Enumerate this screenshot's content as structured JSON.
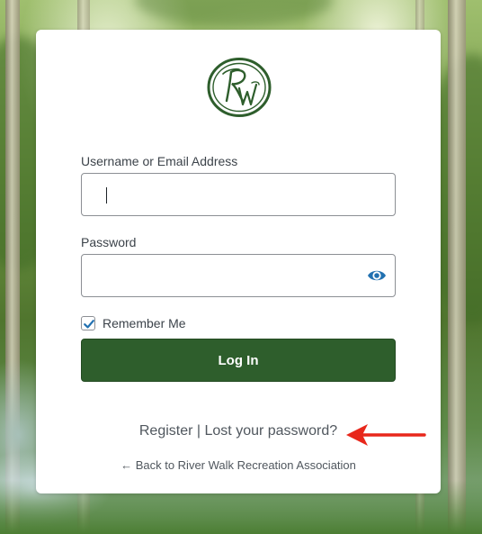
{
  "logo": {
    "monogram": "RW",
    "color": "#2e5e2c"
  },
  "form": {
    "username_label": "Username or Email Address",
    "username_value": "",
    "password_label": "Password",
    "password_value": "",
    "show_password_icon": "eye-icon",
    "remember_label": "Remember Me",
    "remember_checked": true,
    "login_label": "Log In",
    "button_color": "#2e5e2c",
    "accent_color": "#2271b1"
  },
  "nav": {
    "register_label": "Register",
    "separator": "|",
    "lost_password_label": "Lost your password?"
  },
  "back_link": "← Back to River Walk Recreation Association",
  "annotation": {
    "icon": "red-arrow",
    "color": "#e8271b"
  }
}
